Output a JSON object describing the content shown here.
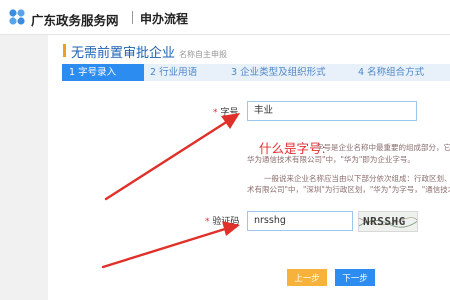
{
  "header": {
    "site_title": "广东政务服务网",
    "process_title": "申办流程"
  },
  "section": {
    "title": "无需前置审批企业",
    "subtitle": "名称自主申报"
  },
  "steps": [
    {
      "label": "1 字号录入",
      "active": true
    },
    {
      "label": "2 行业用语",
      "active": false
    },
    {
      "label": "3 企业类型及组织形式",
      "active": false
    },
    {
      "label": "4 名称组合方式",
      "active": false
    }
  ],
  "form": {
    "required_mark": "*",
    "name_label": "字号",
    "name_value": "丰业",
    "captcha_label": "验证码",
    "captcha_value": "nrsshg",
    "captcha_image_text": "NRSSHG"
  },
  "help": {
    "title": "什么是字号:",
    "line1": "字号是企业名称中最重要的组成部分，它",
    "line2": "华为通信技术有限公司\"中，\"华为\"即为企业字号。",
    "line3": "一般说来企业名称应当由以下部分依次组成：行政区划、",
    "line4": "术有限公司\"中，\"深圳\"为行政区划，\"华为\"为字号，\"通信技术"
  },
  "buttons": {
    "prev": "上一步",
    "next": "下一步"
  },
  "colors": {
    "accent_blue": "#2d8cf0",
    "title_blue": "#1e62b3",
    "warning_red": "#e53030",
    "annotation_arrow": "#e0302a",
    "prev_button": "#f6b23a"
  }
}
